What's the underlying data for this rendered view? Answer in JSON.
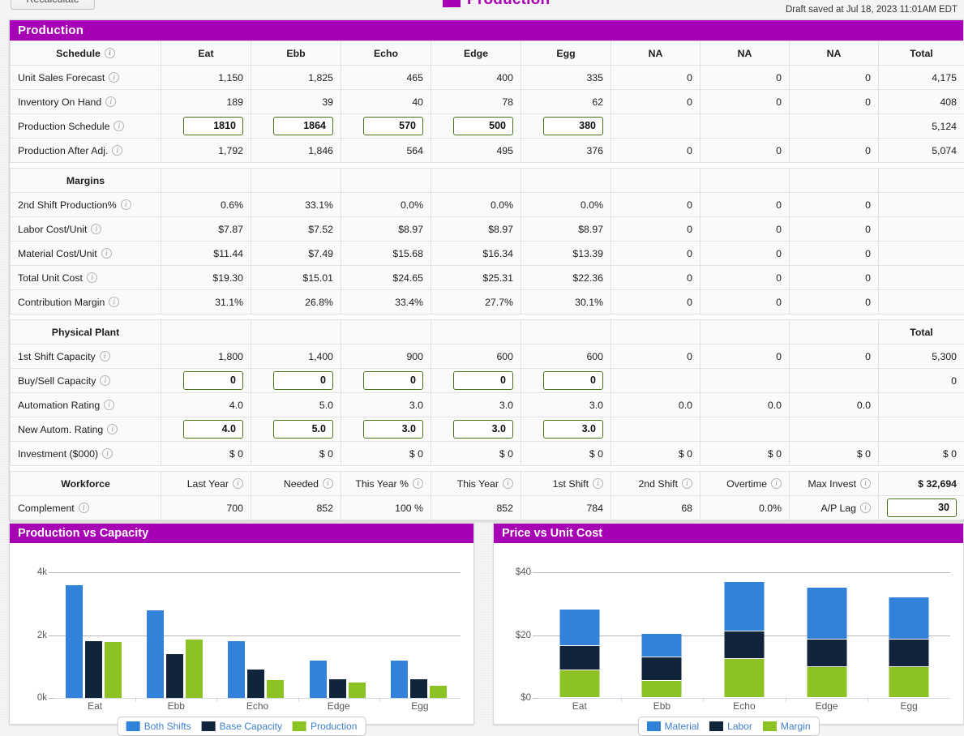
{
  "topbar": {
    "recalculate_label": "Recalculate",
    "page_title": "Production",
    "draft_saved": "Draft saved at Jul 18, 2023 11:01AM EDT"
  },
  "colors": {
    "brand_magenta": "#a800b4",
    "series_blue": "#3282dc",
    "series_navy": "#12243c",
    "series_green": "#8cc224",
    "input_border": "#4b7416"
  },
  "production_panel": {
    "title": "Production",
    "columns": [
      "Eat",
      "Ebb",
      "Echo",
      "Edge",
      "Egg",
      "NA",
      "NA",
      "NA",
      "Total"
    ],
    "sections": [
      {
        "header_label": "Schedule",
        "header_has_info": true,
        "rows": [
          {
            "label": "Unit Sales Forecast",
            "info": true,
            "type": "text",
            "values": [
              "1,150",
              "1,825",
              "465",
              "400",
              "335",
              "0",
              "0",
              "0",
              "4,175"
            ]
          },
          {
            "label": "Inventory On Hand",
            "info": true,
            "type": "text",
            "values": [
              "189",
              "39",
              "40",
              "78",
              "62",
              "0",
              "0",
              "0",
              "408"
            ]
          },
          {
            "label": "Production Schedule",
            "info": true,
            "type": "input",
            "input_cols": 5,
            "values": [
              "1810",
              "1864",
              "570",
              "500",
              "380",
              "",
              "",
              "",
              "5,124"
            ]
          },
          {
            "label": "Production After Adj.",
            "info": true,
            "type": "text",
            "values": [
              "1,792",
              "1,846",
              "564",
              "495",
              "376",
              "0",
              "0",
              "0",
              "5,074"
            ]
          }
        ]
      },
      {
        "header_label": "Margins",
        "header_has_info": false,
        "rows": [
          {
            "label": "2nd Shift Production%",
            "info": true,
            "type": "text",
            "values": [
              "0.6%",
              "33.1%",
              "0.0%",
              "0.0%",
              "0.0%",
              "0",
              "0",
              "0",
              ""
            ]
          },
          {
            "label": "Labor Cost/Unit",
            "info": true,
            "type": "text",
            "values": [
              "$7.87",
              "$7.52",
              "$8.97",
              "$8.97",
              "$8.97",
              "0",
              "0",
              "0",
              ""
            ]
          },
          {
            "label": "Material Cost/Unit",
            "info": true,
            "type": "text",
            "values": [
              "$11.44",
              "$7.49",
              "$15.68",
              "$16.34",
              "$13.39",
              "0",
              "0",
              "0",
              ""
            ]
          },
          {
            "label": "Total Unit Cost",
            "info": true,
            "type": "text",
            "values": [
              "$19.30",
              "$15.01",
              "$24.65",
              "$25.31",
              "$22.36",
              "0",
              "0",
              "0",
              ""
            ]
          },
          {
            "label": "Contribution Margin",
            "info": true,
            "type": "text",
            "values": [
              "31.1%",
              "26.8%",
              "33.4%",
              "27.7%",
              "30.1%",
              "0",
              "0",
              "0",
              ""
            ]
          }
        ]
      },
      {
        "header_label": "Physical Plant",
        "header_has_info": false,
        "header_total_label": "Total",
        "rows": [
          {
            "label": "1st Shift Capacity",
            "info": true,
            "type": "text",
            "values": [
              "1,800",
              "1,400",
              "900",
              "600",
              "600",
              "0",
              "0",
              "0",
              "5,300"
            ]
          },
          {
            "label": "Buy/Sell Capacity",
            "info": true,
            "type": "input",
            "input_cols": 5,
            "values": [
              "0",
              "0",
              "0",
              "0",
              "0",
              "",
              "",
              "",
              "0"
            ]
          },
          {
            "label": "Automation Rating",
            "info": true,
            "type": "text",
            "values": [
              "4.0",
              "5.0",
              "3.0",
              "3.0",
              "3.0",
              "0.0",
              "0.0",
              "0.0",
              ""
            ]
          },
          {
            "label": "New Autom. Rating",
            "info": true,
            "type": "input",
            "input_cols": 5,
            "values": [
              "4.0",
              "5.0",
              "3.0",
              "3.0",
              "3.0",
              "",
              "",
              "",
              ""
            ]
          },
          {
            "label": "Investment ($000)",
            "info": true,
            "type": "text",
            "values": [
              "$ 0",
              "$ 0",
              "$ 0",
              "$ 0",
              "$ 0",
              "$ 0",
              "$ 0",
              "$ 0",
              "$ 0"
            ]
          }
        ]
      }
    ],
    "workforce": {
      "section_label": "Workforce",
      "column_headers": [
        {
          "label": "Last Year",
          "info": true
        },
        {
          "label": "Needed",
          "info": true
        },
        {
          "label": "This Year %",
          "info": true
        },
        {
          "label": "This Year",
          "info": true
        },
        {
          "label": "1st Shift",
          "info": true
        },
        {
          "label": "2nd Shift",
          "info": true
        },
        {
          "label": "Overtime",
          "info": true
        },
        {
          "label": "Max Invest",
          "info": true
        }
      ],
      "total_value": "$ 32,694",
      "row": {
        "label": "Complement",
        "info": true,
        "values": [
          "700",
          "852",
          "100 %",
          "852",
          "784",
          "68",
          "0.0%"
        ],
        "ap_lag_label": "A/P Lag",
        "ap_lag_value": "30"
      }
    }
  },
  "chart_data": [
    {
      "type": "bar",
      "title": "Production vs Capacity",
      "categories": [
        "Eat",
        "Ebb",
        "Echo",
        "Edge",
        "Egg"
      ],
      "series": [
        {
          "name": "Both Shifts",
          "color": "#3282dc",
          "values": [
            3600,
            2800,
            1800,
            1200,
            1200
          ]
        },
        {
          "name": "Base Capacity",
          "color": "#12243c",
          "values": [
            1800,
            1400,
            900,
            600,
            600
          ]
        },
        {
          "name": "Production",
          "color": "#8cc224",
          "values": [
            1792,
            1846,
            564,
            495,
            376
          ]
        }
      ],
      "ylim": [
        0,
        4000
      ],
      "yticks": [
        0,
        2000,
        4000
      ],
      "ytick_labels": [
        "0k",
        "2k",
        "4k"
      ],
      "xlabel": "",
      "ylabel": "",
      "grid": true,
      "legend_position": "bottom"
    },
    {
      "type": "bar",
      "stacked": true,
      "title": "Price vs Unit Cost",
      "categories": [
        "Eat",
        "Ebb",
        "Echo",
        "Edge",
        "Egg"
      ],
      "series": [
        {
          "name": "Margin",
          "color": "#8cc224",
          "values": [
            8.7,
            5.5,
            12.3,
            9.7,
            9.7
          ]
        },
        {
          "name": "Labor",
          "color": "#12243c",
          "values": [
            7.87,
            7.52,
            8.97,
            8.97,
            8.97
          ]
        },
        {
          "name": "Material",
          "color": "#3282dc",
          "values": [
            11.44,
            7.49,
            15.68,
            16.34,
            13.39
          ]
        }
      ],
      "totals": [
        28.01,
        20.51,
        36.95,
        35.01,
        32.06
      ],
      "ylim": [
        0,
        40
      ],
      "yticks": [
        0,
        20,
        40
      ],
      "ytick_labels": [
        "$0",
        "$20",
        "$40"
      ],
      "xlabel": "",
      "ylabel": "",
      "grid": true,
      "legend_position": "bottom",
      "legend_order": [
        "Material",
        "Labor",
        "Margin"
      ]
    }
  ]
}
